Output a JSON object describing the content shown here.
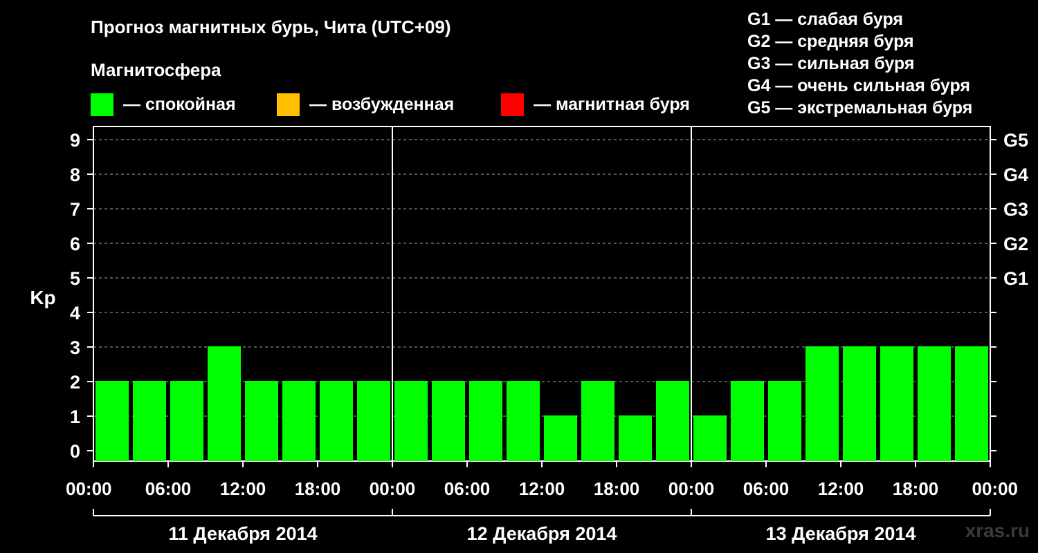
{
  "title": "Прогноз магнитных бурь, Чита (UTC+09)",
  "magnetosphere_title": "Магнитосфера",
  "legend": [
    {
      "color": "#00ff00",
      "label": "— спокойная"
    },
    {
      "color": "#ffc000",
      "label": "— возбужденная"
    },
    {
      "color": "#ff0000",
      "label": "— магнитная буря"
    }
  ],
  "g_legend": [
    "G1 — слабая буря",
    "G2 — средняя буря",
    "G3 — сильная буря",
    "G4 — очень сильная буря",
    "G5 — экстремальная буря"
  ],
  "watermark": "xras.ru",
  "chart_data": {
    "type": "bar",
    "ylabel": "Kp",
    "ylim": [
      0,
      9
    ],
    "yticks": [
      "0",
      "1",
      "2",
      "3",
      "4",
      "5",
      "6",
      "7",
      "8",
      "9"
    ],
    "right_ticks": [
      {
        "value": 5,
        "label": "G1"
      },
      {
        "value": 6,
        "label": "G2"
      },
      {
        "value": 7,
        "label": "G3"
      },
      {
        "value": 8,
        "label": "G4"
      },
      {
        "value": 9,
        "label": "G5"
      }
    ],
    "grid": "dashed horizontal",
    "xticks": [
      "00:00",
      "06:00",
      "12:00",
      "18:00",
      "00:00",
      "06:00",
      "12:00",
      "18:00",
      "00:00",
      "06:00",
      "12:00",
      "18:00",
      "00:00"
    ],
    "days": [
      "11 Декабря 2014",
      "12 Декабря 2014",
      "13 Декабря 2014"
    ],
    "series": [
      {
        "values": [
          2,
          2,
          2,
          3,
          2,
          2,
          2,
          2,
          2,
          2,
          2,
          2,
          1,
          2,
          1,
          2,
          1,
          2,
          2,
          3,
          3,
          3,
          3,
          3
        ],
        "color": "#00ff00"
      }
    ]
  }
}
